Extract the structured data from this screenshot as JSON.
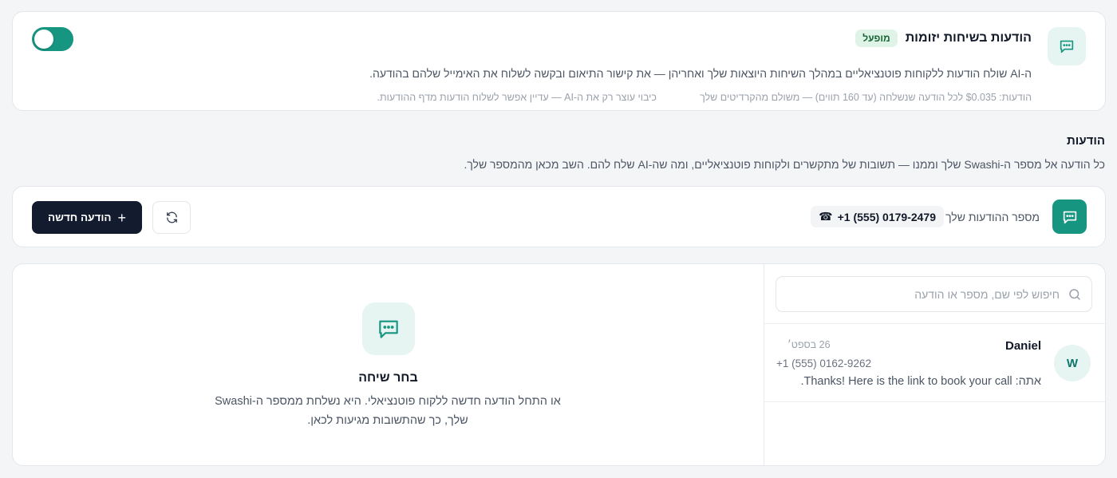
{
  "colors": {
    "accent": "#169580",
    "accent_light": "#e6f5f1",
    "badge_bg": "#dff3e7",
    "badge_text": "#166534",
    "primary_button": "#131b2e",
    "page_bg": "#f4f5f7"
  },
  "feature": {
    "icon": "message-icon",
    "title": "הודעות בשיחות יזומות",
    "badge": "מופעל",
    "description": "ה-AI שולח הודעות ללקוחות פוטנציאליים במהלך השיחות היוצאות שלך ואחריהן — את קישור התיאום ובקשה לשלוח את האימייל שלהם בהודעה.",
    "pricing": "הודעות: $0.035 לכל הודעה שנשלחה (עד 160 תווים) — משולם מהקרדיטים שלך",
    "note": "כיבוי עוצר רק את ה-AI — עדיין אפשר לשלוח הודעות מדף ההודעות.",
    "enabled": true
  },
  "messages_section": {
    "title": "הודעות",
    "description": "כל הודעה אל מספר ה-Swashi שלך וממנו — תשובות של מתקשרים ולקוחות פוטנציאליים, ומה שה-AI שלח להם. השב מכאן מהמספר שלך."
  },
  "toolbar": {
    "icon": "message-icon",
    "number_label": "מספר ההודעות שלך",
    "phone_icon": "phone-icon",
    "phone_number": "+1 (555) 0179-2479",
    "refresh_icon": "refresh-icon",
    "new_message_label": "הודעה חדשה",
    "plus_icon": "plus-icon"
  },
  "search": {
    "placeholder": "חיפוש לפי שם, מספר או הודעה",
    "value": "",
    "icon": "search-icon"
  },
  "conversations": [
    {
      "avatar": "W",
      "name": "Daniel",
      "date": "26 בספט׳",
      "phone": "+1 (555) 0162-9262",
      "preview": "אתה: Thanks! Here is the link to book your call."
    }
  ],
  "empty_state": {
    "icon": "message-icon",
    "title": "בחר שיחה",
    "description": "או התחל הודעה חדשה ללקוח פוטנציאלי. היא נשלחת ממספר ה-Swashi שלך, כך שהתשובות מגיעות לכאן."
  }
}
